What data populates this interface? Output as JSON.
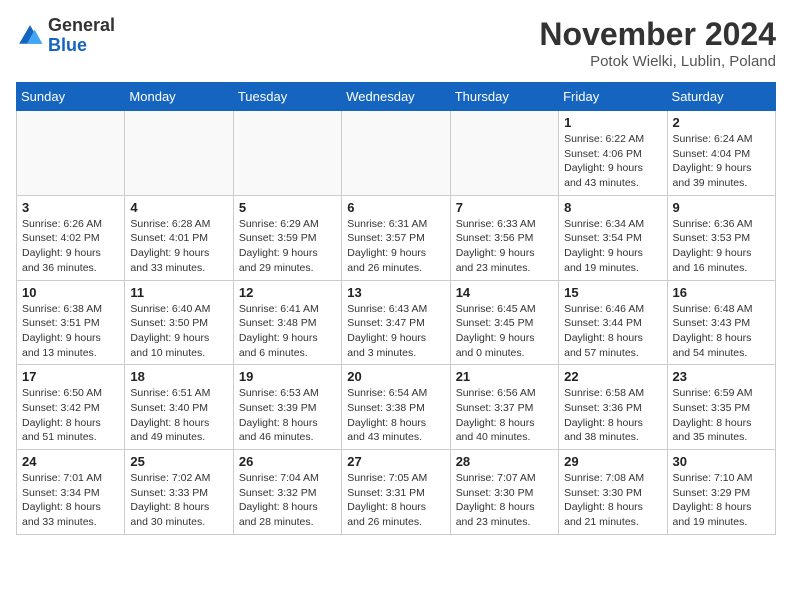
{
  "logo": {
    "general": "General",
    "blue": "Blue"
  },
  "header": {
    "month": "November 2024",
    "location": "Potok Wielki, Lublin, Poland"
  },
  "weekdays": [
    "Sunday",
    "Monday",
    "Tuesday",
    "Wednesday",
    "Thursday",
    "Friday",
    "Saturday"
  ],
  "weeks": [
    [
      {
        "day": "",
        "info": ""
      },
      {
        "day": "",
        "info": ""
      },
      {
        "day": "",
        "info": ""
      },
      {
        "day": "",
        "info": ""
      },
      {
        "day": "",
        "info": ""
      },
      {
        "day": "1",
        "info": "Sunrise: 6:22 AM\nSunset: 4:06 PM\nDaylight: 9 hours and 43 minutes."
      },
      {
        "day": "2",
        "info": "Sunrise: 6:24 AM\nSunset: 4:04 PM\nDaylight: 9 hours and 39 minutes."
      }
    ],
    [
      {
        "day": "3",
        "info": "Sunrise: 6:26 AM\nSunset: 4:02 PM\nDaylight: 9 hours and 36 minutes."
      },
      {
        "day": "4",
        "info": "Sunrise: 6:28 AM\nSunset: 4:01 PM\nDaylight: 9 hours and 33 minutes."
      },
      {
        "day": "5",
        "info": "Sunrise: 6:29 AM\nSunset: 3:59 PM\nDaylight: 9 hours and 29 minutes."
      },
      {
        "day": "6",
        "info": "Sunrise: 6:31 AM\nSunset: 3:57 PM\nDaylight: 9 hours and 26 minutes."
      },
      {
        "day": "7",
        "info": "Sunrise: 6:33 AM\nSunset: 3:56 PM\nDaylight: 9 hours and 23 minutes."
      },
      {
        "day": "8",
        "info": "Sunrise: 6:34 AM\nSunset: 3:54 PM\nDaylight: 9 hours and 19 minutes."
      },
      {
        "day": "9",
        "info": "Sunrise: 6:36 AM\nSunset: 3:53 PM\nDaylight: 9 hours and 16 minutes."
      }
    ],
    [
      {
        "day": "10",
        "info": "Sunrise: 6:38 AM\nSunset: 3:51 PM\nDaylight: 9 hours and 13 minutes."
      },
      {
        "day": "11",
        "info": "Sunrise: 6:40 AM\nSunset: 3:50 PM\nDaylight: 9 hours and 10 minutes."
      },
      {
        "day": "12",
        "info": "Sunrise: 6:41 AM\nSunset: 3:48 PM\nDaylight: 9 hours and 6 minutes."
      },
      {
        "day": "13",
        "info": "Sunrise: 6:43 AM\nSunset: 3:47 PM\nDaylight: 9 hours and 3 minutes."
      },
      {
        "day": "14",
        "info": "Sunrise: 6:45 AM\nSunset: 3:45 PM\nDaylight: 9 hours and 0 minutes."
      },
      {
        "day": "15",
        "info": "Sunrise: 6:46 AM\nSunset: 3:44 PM\nDaylight: 8 hours and 57 minutes."
      },
      {
        "day": "16",
        "info": "Sunrise: 6:48 AM\nSunset: 3:43 PM\nDaylight: 8 hours and 54 minutes."
      }
    ],
    [
      {
        "day": "17",
        "info": "Sunrise: 6:50 AM\nSunset: 3:42 PM\nDaylight: 8 hours and 51 minutes."
      },
      {
        "day": "18",
        "info": "Sunrise: 6:51 AM\nSunset: 3:40 PM\nDaylight: 8 hours and 49 minutes."
      },
      {
        "day": "19",
        "info": "Sunrise: 6:53 AM\nSunset: 3:39 PM\nDaylight: 8 hours and 46 minutes."
      },
      {
        "day": "20",
        "info": "Sunrise: 6:54 AM\nSunset: 3:38 PM\nDaylight: 8 hours and 43 minutes."
      },
      {
        "day": "21",
        "info": "Sunrise: 6:56 AM\nSunset: 3:37 PM\nDaylight: 8 hours and 40 minutes."
      },
      {
        "day": "22",
        "info": "Sunrise: 6:58 AM\nSunset: 3:36 PM\nDaylight: 8 hours and 38 minutes."
      },
      {
        "day": "23",
        "info": "Sunrise: 6:59 AM\nSunset: 3:35 PM\nDaylight: 8 hours and 35 minutes."
      }
    ],
    [
      {
        "day": "24",
        "info": "Sunrise: 7:01 AM\nSunset: 3:34 PM\nDaylight: 8 hours and 33 minutes."
      },
      {
        "day": "25",
        "info": "Sunrise: 7:02 AM\nSunset: 3:33 PM\nDaylight: 8 hours and 30 minutes."
      },
      {
        "day": "26",
        "info": "Sunrise: 7:04 AM\nSunset: 3:32 PM\nDaylight: 8 hours and 28 minutes."
      },
      {
        "day": "27",
        "info": "Sunrise: 7:05 AM\nSunset: 3:31 PM\nDaylight: 8 hours and 26 minutes."
      },
      {
        "day": "28",
        "info": "Sunrise: 7:07 AM\nSunset: 3:30 PM\nDaylight: 8 hours and 23 minutes."
      },
      {
        "day": "29",
        "info": "Sunrise: 7:08 AM\nSunset: 3:30 PM\nDaylight: 8 hours and 21 minutes."
      },
      {
        "day": "30",
        "info": "Sunrise: 7:10 AM\nSunset: 3:29 PM\nDaylight: 8 hours and 19 minutes."
      }
    ]
  ]
}
